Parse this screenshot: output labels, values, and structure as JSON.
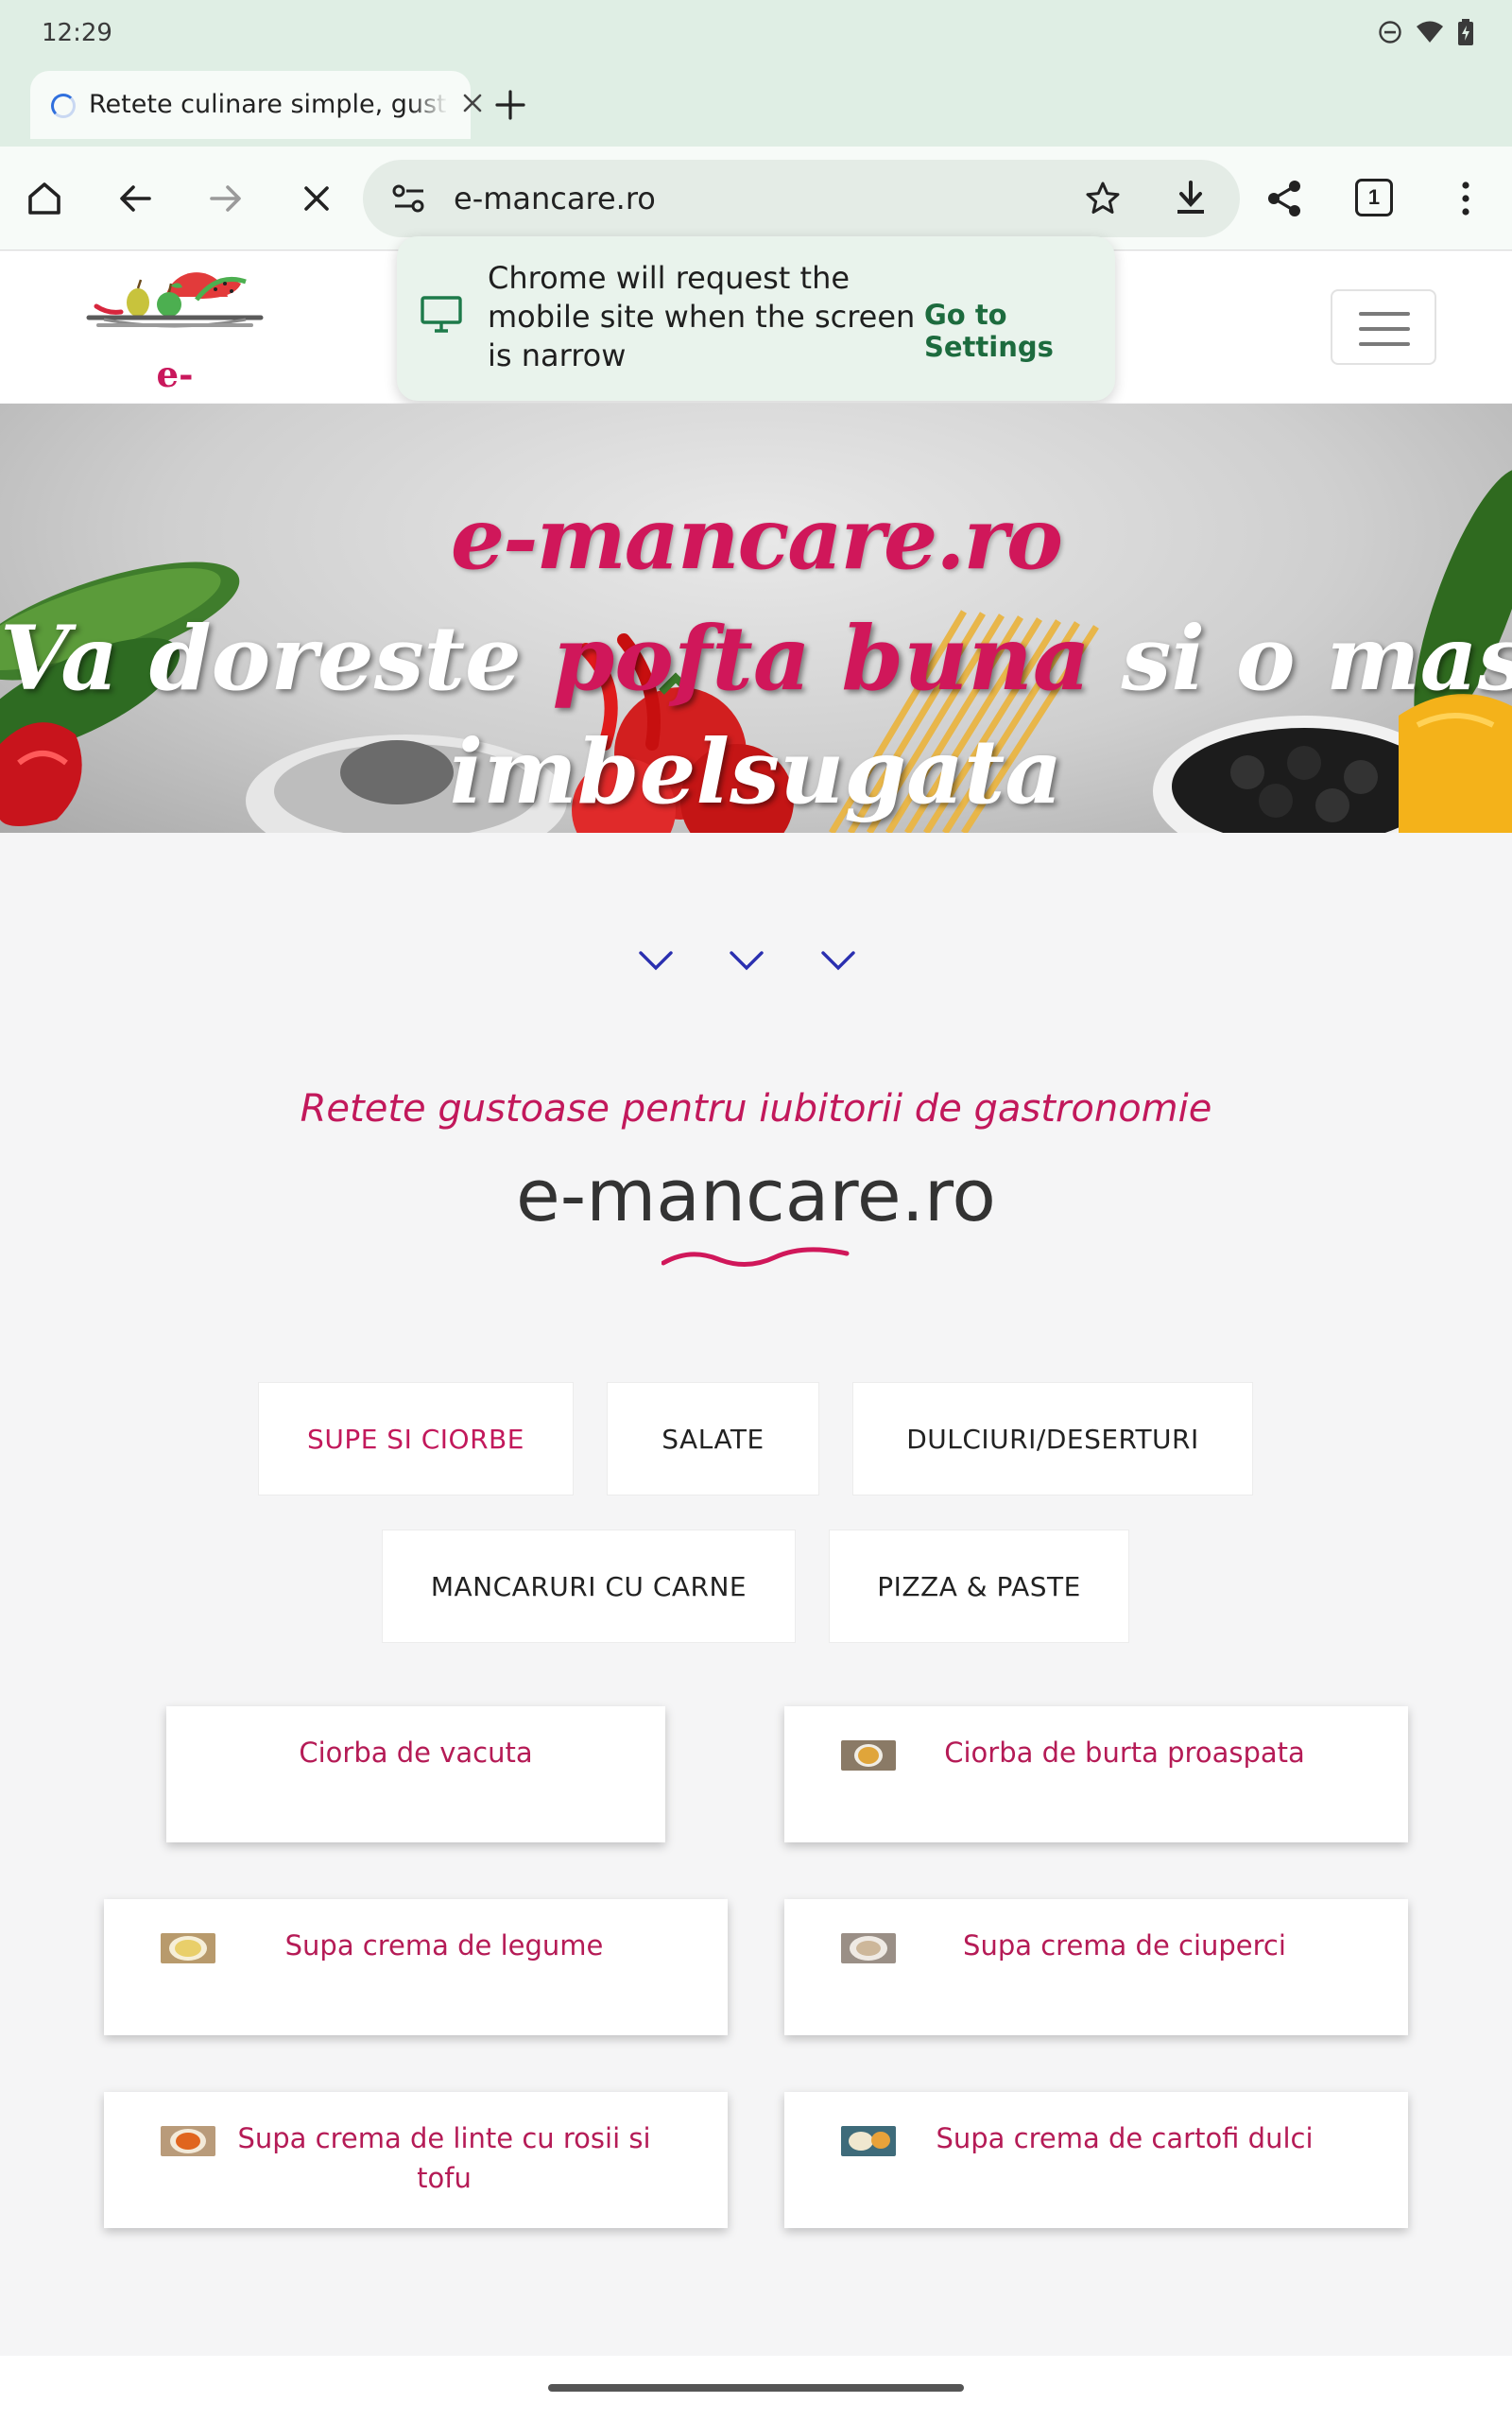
{
  "status_bar": {
    "time": "12:29",
    "icons": [
      "do-not-disturb-icon",
      "wifi-icon",
      "battery-charging-icon"
    ]
  },
  "browser": {
    "tab_title": "Retete culinare simple, gustoase",
    "url": "e-mancare.ro",
    "tab_count": "1"
  },
  "popup": {
    "message": "Chrome will request the mobile site when the screen is narrow",
    "link": "Go to Settings"
  },
  "site": {
    "logo_text": "e-mancare",
    "hero": {
      "title": "e-mancare.ro",
      "line1_white_a": "Va doreste ",
      "line1_pink": "pofta buna",
      "line1_white_b": " si o masa",
      "line2": "imbelsugata"
    },
    "tagline": "Retete gustoase pentru iubitorii de gastronomie",
    "name": "e-mancare.ro"
  },
  "categories": [
    {
      "label": "SUPE SI CIORBE",
      "active": true
    },
    {
      "label": "SALATE",
      "active": false
    },
    {
      "label": "DULCIURI/DESERTURI",
      "active": false
    },
    {
      "label": "MANCARURI CU CARNE",
      "active": false
    },
    {
      "label": "PIZZA & PASTE",
      "active": false
    }
  ],
  "recipes": [
    {
      "title": "Ciorba de vacuta"
    },
    {
      "title": "Ciorba de burta proaspata"
    },
    {
      "title": "Supa crema de legume"
    },
    {
      "title": "Supa crema de ciuperci"
    },
    {
      "title": "Supa crema de linte cu rosii si tofu"
    },
    {
      "title": "Supa crema de cartofi dulci"
    }
  ],
  "colors": {
    "brand_pink": "#c2185b",
    "chrome_green": "#dfeee4",
    "link_green": "#1d6b3e"
  }
}
